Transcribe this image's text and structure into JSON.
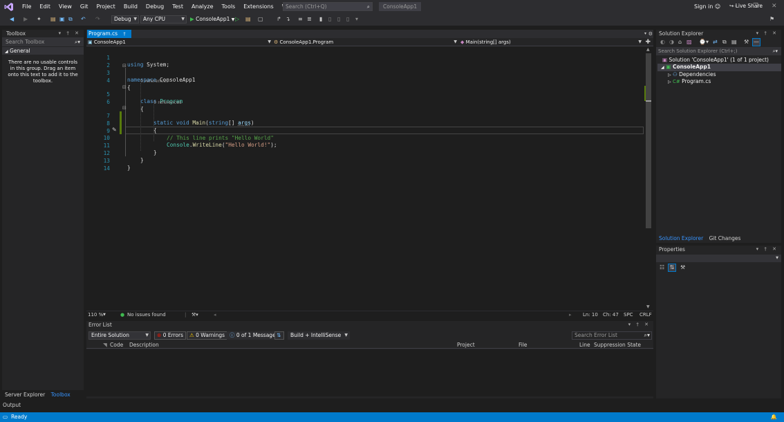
{
  "menu": {
    "items": [
      "File",
      "Edit",
      "View",
      "Git",
      "Project",
      "Build",
      "Debug",
      "Test",
      "Analyze",
      "Tools",
      "Extensions",
      "Window",
      "Help"
    ],
    "search_placeholder": "Search (Ctrl+Q)",
    "app_name": "ConsoleApp1",
    "sign_in": "Sign in",
    "live_share": "Live Share"
  },
  "toolbar": {
    "configuration": "Debug",
    "platform": "Any CPU",
    "run_target": "ConsoleApp1"
  },
  "toolbox": {
    "title": "Toolbox",
    "search_placeholder": "Search Toolbox",
    "group": "General",
    "empty_message": "There are no usable controls in this group. Drag an item onto this text to add it to the toolbox."
  },
  "editor": {
    "tab": "Program.cs",
    "nav_project": "ConsoleApp1",
    "nav_class": "ConsoleApp1.Program",
    "nav_member": "Main(string[] args)",
    "refs_class": "0 references",
    "refs_method": "0 references",
    "line_numbers": [
      "1",
      "2",
      "3",
      "4",
      "5",
      "6",
      "7",
      "8",
      "9",
      "10",
      "11",
      "12",
      "13",
      "14"
    ],
    "code": {
      "l1_kw": "using",
      "l1_rest": " System;",
      "l3_kw": "namespace",
      "l3_rest": " ConsoleApp1",
      "brace_open": "{",
      "brace_close": "}",
      "l5_kw": "class",
      "l5_type": "Program",
      "l7_kw1": "static",
      "l7_kw2": "void",
      "l7_fn": "Main",
      "l7_p1": "(",
      "l7_kw3": "string",
      "l7_p2": "[] ",
      "l7_param": "args",
      "l7_p3": ")",
      "l9_comment": "// This line prints \"Hello World\"",
      "l10_type": "Console",
      "l10_dot": ".",
      "l10_fn": "WriteLine",
      "l10_p1": "(",
      "l10_str": "\"Hello World!\"",
      "l10_p2": ");"
    },
    "zoom": "110 %",
    "issues": "No issues found",
    "ln": "Ln: 10",
    "ch": "Ch: 47",
    "spc": "SPC",
    "crlf": "CRLF"
  },
  "error_list": {
    "title": "Error List",
    "scope": "Entire Solution",
    "errors": "0 Errors",
    "warnings": "0 Warnings",
    "messages": "0 of 1 Message",
    "build_filter": "Build + IntelliSense",
    "search_placeholder": "Search Error List",
    "columns": [
      "Code",
      "Description",
      "Project",
      "File",
      "Line",
      "Suppression State"
    ]
  },
  "solution_explorer": {
    "title": "Solution Explorer",
    "search_placeholder": "Search Solution Explorer (Ctrl+;)",
    "solution": "Solution 'ConsoleApp1' (1 of 1 project)",
    "project": "ConsoleApp1",
    "dependencies": "Dependencies",
    "file": "Program.cs",
    "tab_solution": "Solution Explorer",
    "tab_git": "Git Changes"
  },
  "properties": {
    "title": "Properties"
  },
  "bottom_tabs": {
    "server_explorer": "Server Explorer",
    "toolbox": "Toolbox",
    "output": "Output"
  },
  "status": {
    "ready": "Ready"
  },
  "colors": {
    "accent": "#007acc",
    "keyword": "#569cd6",
    "type": "#4ec9b0",
    "string": "#d69d85",
    "comment": "#57a64a",
    "success": "#3fb950",
    "error": "#e51400",
    "warning": "#ffcc00"
  }
}
